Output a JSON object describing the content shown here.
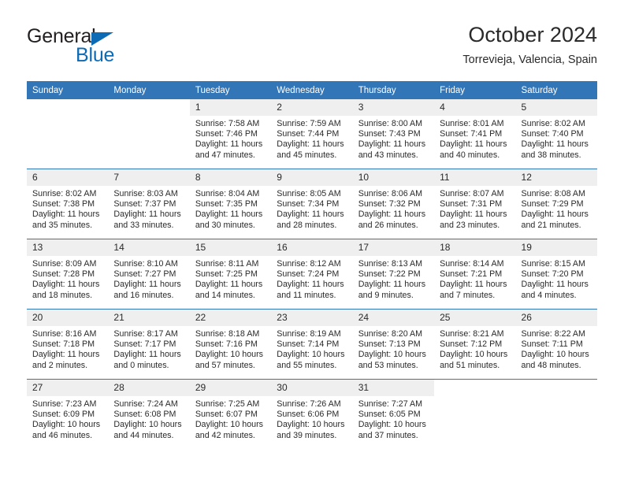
{
  "brand": {
    "name_part1": "General",
    "name_part2": "Blue",
    "triangle_color": "#0d6bb5"
  },
  "header": {
    "title": "October 2024",
    "subtitle": "Torrevieja, Valencia, Spain",
    "accent_color": "#3376b8",
    "daynum_band_color": "#efefef"
  },
  "weekdays": [
    "Sunday",
    "Monday",
    "Tuesday",
    "Wednesday",
    "Thursday",
    "Friday",
    "Saturday"
  ],
  "weeks": [
    [
      {
        "day": "",
        "empty": true
      },
      {
        "day": "",
        "empty": true
      },
      {
        "day": "1",
        "sunrise": "Sunrise: 7:58 AM",
        "sunset": "Sunset: 7:46 PM",
        "daylight": "Daylight: 11 hours and 47 minutes."
      },
      {
        "day": "2",
        "sunrise": "Sunrise: 7:59 AM",
        "sunset": "Sunset: 7:44 PM",
        "daylight": "Daylight: 11 hours and 45 minutes."
      },
      {
        "day": "3",
        "sunrise": "Sunrise: 8:00 AM",
        "sunset": "Sunset: 7:43 PM",
        "daylight": "Daylight: 11 hours and 43 minutes."
      },
      {
        "day": "4",
        "sunrise": "Sunrise: 8:01 AM",
        "sunset": "Sunset: 7:41 PM",
        "daylight": "Daylight: 11 hours and 40 minutes."
      },
      {
        "day": "5",
        "sunrise": "Sunrise: 8:02 AM",
        "sunset": "Sunset: 7:40 PM",
        "daylight": "Daylight: 11 hours and 38 minutes."
      }
    ],
    [
      {
        "day": "6",
        "sunrise": "Sunrise: 8:02 AM",
        "sunset": "Sunset: 7:38 PM",
        "daylight": "Daylight: 11 hours and 35 minutes."
      },
      {
        "day": "7",
        "sunrise": "Sunrise: 8:03 AM",
        "sunset": "Sunset: 7:37 PM",
        "daylight": "Daylight: 11 hours and 33 minutes."
      },
      {
        "day": "8",
        "sunrise": "Sunrise: 8:04 AM",
        "sunset": "Sunset: 7:35 PM",
        "daylight": "Daylight: 11 hours and 30 minutes."
      },
      {
        "day": "9",
        "sunrise": "Sunrise: 8:05 AM",
        "sunset": "Sunset: 7:34 PM",
        "daylight": "Daylight: 11 hours and 28 minutes."
      },
      {
        "day": "10",
        "sunrise": "Sunrise: 8:06 AM",
        "sunset": "Sunset: 7:32 PM",
        "daylight": "Daylight: 11 hours and 26 minutes."
      },
      {
        "day": "11",
        "sunrise": "Sunrise: 8:07 AM",
        "sunset": "Sunset: 7:31 PM",
        "daylight": "Daylight: 11 hours and 23 minutes."
      },
      {
        "day": "12",
        "sunrise": "Sunrise: 8:08 AM",
        "sunset": "Sunset: 7:29 PM",
        "daylight": "Daylight: 11 hours and 21 minutes."
      }
    ],
    [
      {
        "day": "13",
        "sunrise": "Sunrise: 8:09 AM",
        "sunset": "Sunset: 7:28 PM",
        "daylight": "Daylight: 11 hours and 18 minutes."
      },
      {
        "day": "14",
        "sunrise": "Sunrise: 8:10 AM",
        "sunset": "Sunset: 7:27 PM",
        "daylight": "Daylight: 11 hours and 16 minutes."
      },
      {
        "day": "15",
        "sunrise": "Sunrise: 8:11 AM",
        "sunset": "Sunset: 7:25 PM",
        "daylight": "Daylight: 11 hours and 14 minutes."
      },
      {
        "day": "16",
        "sunrise": "Sunrise: 8:12 AM",
        "sunset": "Sunset: 7:24 PM",
        "daylight": "Daylight: 11 hours and 11 minutes."
      },
      {
        "day": "17",
        "sunrise": "Sunrise: 8:13 AM",
        "sunset": "Sunset: 7:22 PM",
        "daylight": "Daylight: 11 hours and 9 minutes."
      },
      {
        "day": "18",
        "sunrise": "Sunrise: 8:14 AM",
        "sunset": "Sunset: 7:21 PM",
        "daylight": "Daylight: 11 hours and 7 minutes."
      },
      {
        "day": "19",
        "sunrise": "Sunrise: 8:15 AM",
        "sunset": "Sunset: 7:20 PM",
        "daylight": "Daylight: 11 hours and 4 minutes."
      }
    ],
    [
      {
        "day": "20",
        "sunrise": "Sunrise: 8:16 AM",
        "sunset": "Sunset: 7:18 PM",
        "daylight": "Daylight: 11 hours and 2 minutes."
      },
      {
        "day": "21",
        "sunrise": "Sunrise: 8:17 AM",
        "sunset": "Sunset: 7:17 PM",
        "daylight": "Daylight: 11 hours and 0 minutes."
      },
      {
        "day": "22",
        "sunrise": "Sunrise: 8:18 AM",
        "sunset": "Sunset: 7:16 PM",
        "daylight": "Daylight: 10 hours and 57 minutes."
      },
      {
        "day": "23",
        "sunrise": "Sunrise: 8:19 AM",
        "sunset": "Sunset: 7:14 PM",
        "daylight": "Daylight: 10 hours and 55 minutes."
      },
      {
        "day": "24",
        "sunrise": "Sunrise: 8:20 AM",
        "sunset": "Sunset: 7:13 PM",
        "daylight": "Daylight: 10 hours and 53 minutes."
      },
      {
        "day": "25",
        "sunrise": "Sunrise: 8:21 AM",
        "sunset": "Sunset: 7:12 PM",
        "daylight": "Daylight: 10 hours and 51 minutes."
      },
      {
        "day": "26",
        "sunrise": "Sunrise: 8:22 AM",
        "sunset": "Sunset: 7:11 PM",
        "daylight": "Daylight: 10 hours and 48 minutes."
      }
    ],
    [
      {
        "day": "27",
        "sunrise": "Sunrise: 7:23 AM",
        "sunset": "Sunset: 6:09 PM",
        "daylight": "Daylight: 10 hours and 46 minutes."
      },
      {
        "day": "28",
        "sunrise": "Sunrise: 7:24 AM",
        "sunset": "Sunset: 6:08 PM",
        "daylight": "Daylight: 10 hours and 44 minutes."
      },
      {
        "day": "29",
        "sunrise": "Sunrise: 7:25 AM",
        "sunset": "Sunset: 6:07 PM",
        "daylight": "Daylight: 10 hours and 42 minutes."
      },
      {
        "day": "30",
        "sunrise": "Sunrise: 7:26 AM",
        "sunset": "Sunset: 6:06 PM",
        "daylight": "Daylight: 10 hours and 39 minutes."
      },
      {
        "day": "31",
        "sunrise": "Sunrise: 7:27 AM",
        "sunset": "Sunset: 6:05 PM",
        "daylight": "Daylight: 10 hours and 37 minutes."
      },
      {
        "day": "",
        "empty": true
      },
      {
        "day": "",
        "empty": true
      }
    ]
  ]
}
